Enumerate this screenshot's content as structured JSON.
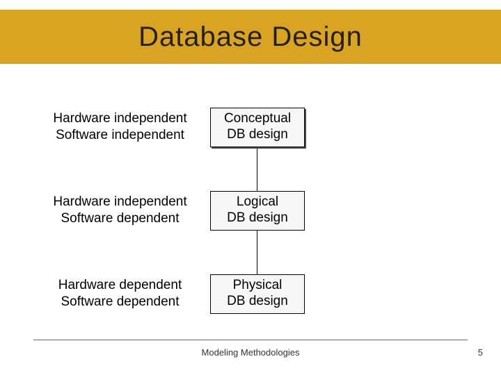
{
  "title": "Database Design",
  "levels": [
    {
      "label_line1": "Hardware independent",
      "label_line2": "Software independent",
      "box_line1": "Conceptual",
      "box_line2": "DB design"
    },
    {
      "label_line1": "Hardware independent",
      "label_line2": "Software dependent",
      "box_line1": "Logical",
      "box_line2": "DB design"
    },
    {
      "label_line1": "Hardware dependent",
      "label_line2": "Software dependent",
      "box_line1": "Physical",
      "box_line2": "DB design"
    }
  ],
  "footer": {
    "caption": "Modeling Methodologies",
    "page": "5"
  }
}
